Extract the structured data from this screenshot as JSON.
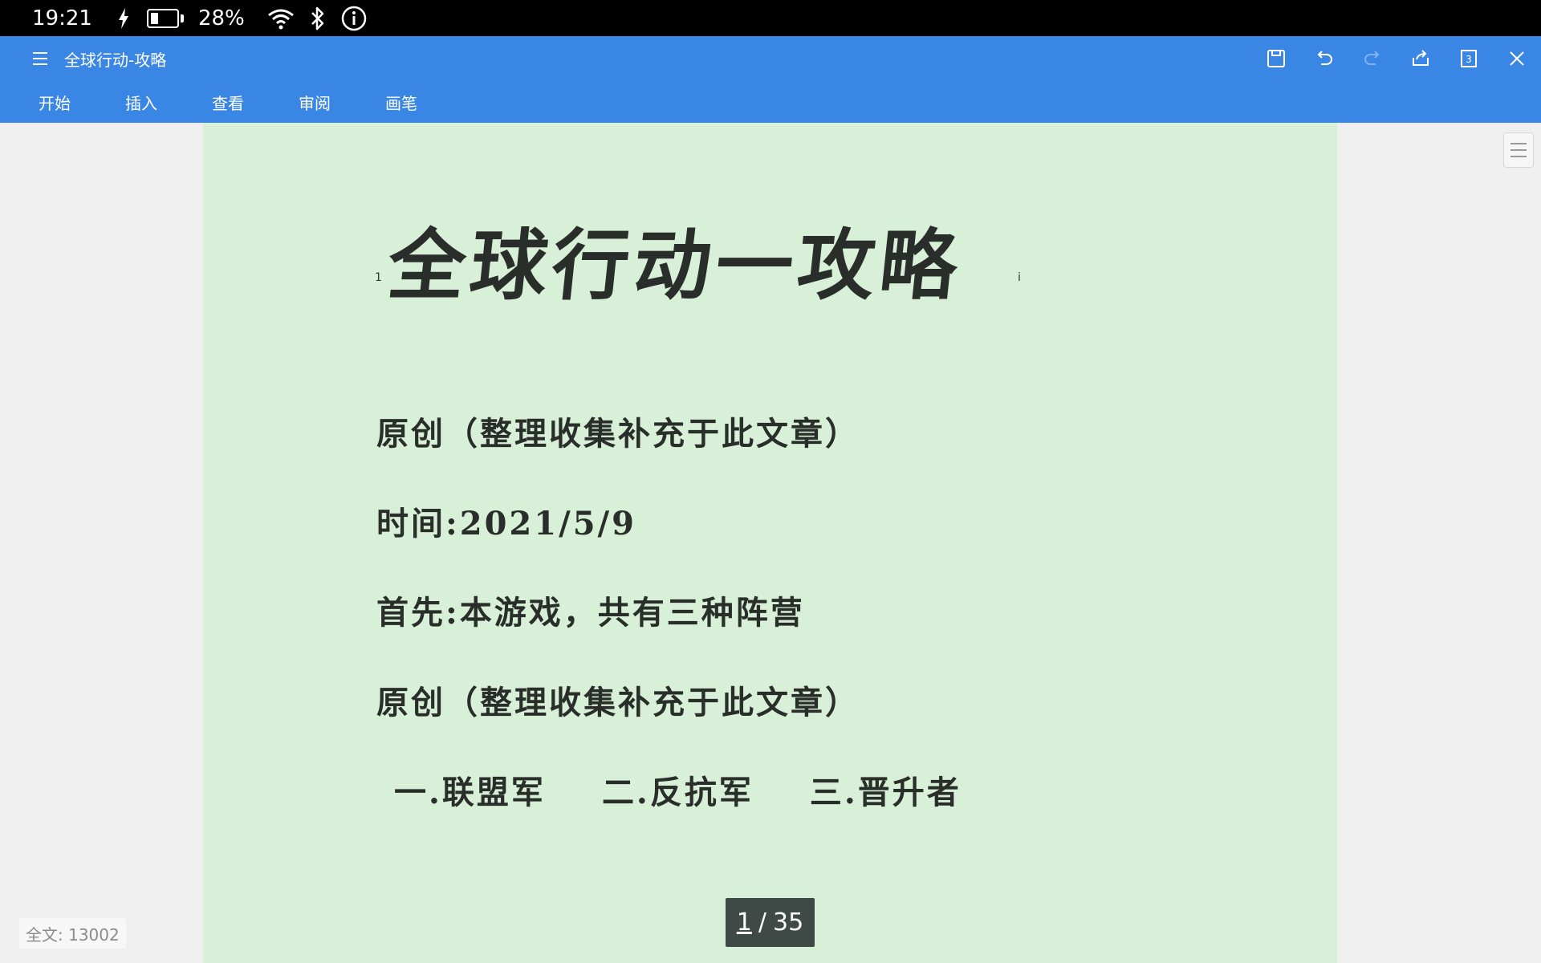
{
  "status_bar": {
    "time": "19:21",
    "battery_percent": "28%",
    "battery_level": 0.28,
    "icons": [
      "charging-bolt-icon",
      "battery-icon",
      "wifi-icon",
      "bluetooth-icon",
      "info-icon"
    ]
  },
  "header": {
    "title": "全球行动-攻略",
    "toolbar_icons": [
      "save-icon",
      "undo-icon",
      "redo-icon",
      "share-icon",
      "page-count-icon",
      "close-icon"
    ],
    "window_count": "3",
    "colors": {
      "bar": "#3a86e4"
    }
  },
  "tabs": [
    {
      "label": "开始"
    },
    {
      "label": "插入"
    },
    {
      "label": "查看"
    },
    {
      "label": "审阅"
    },
    {
      "label": "画笔"
    }
  ],
  "document": {
    "page_color": "#d8efd8",
    "margin_mark_left": "1",
    "margin_mark_right": "i",
    "heading": "全球行动一攻略",
    "lines": [
      "原创（整理收集补充于此文章）",
      "时间:2021/5/9",
      "首先:本游戏，共有三种阵营",
      "原创（整理收集补充于此文章）"
    ],
    "factions": [
      "一.联盟军",
      "二.反抗军",
      "三.晋升者"
    ]
  },
  "page_indicator": {
    "current": "1",
    "separator": "/",
    "total": "35"
  },
  "word_count": {
    "label": "全文: 13002"
  }
}
